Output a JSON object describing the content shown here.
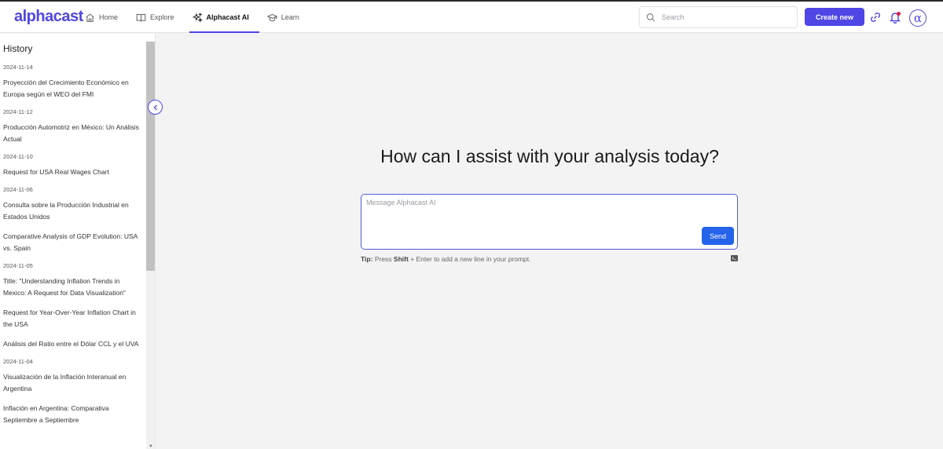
{
  "header": {
    "logo": "alphacast",
    "nav": [
      {
        "label": "Home",
        "icon": "home-icon"
      },
      {
        "label": "Explore",
        "icon": "book-icon"
      },
      {
        "label": "Alphacast AI",
        "icon": "sparkles-icon",
        "active": true
      },
      {
        "label": "Learn",
        "icon": "graduation-cap-icon"
      }
    ],
    "search_placeholder": "Search",
    "create_label": "Create new",
    "avatar_glyph": "α"
  },
  "sidebar": {
    "title": "History",
    "groups": [
      {
        "date": "2024-11-14",
        "items": [
          "Proyección del Crecimiento Económico en Europa según el WEO del FMI"
        ]
      },
      {
        "date": "2024-11-12",
        "items": [
          "Producción Automotriz en México: Un Análisis Actual"
        ]
      },
      {
        "date": "2024-11-10",
        "items": [
          "Request for USA Real Wages Chart"
        ]
      },
      {
        "date": "2024-11-06",
        "items": [
          "Consulta sobre la Producción Industrial en Estados Unidos",
          "Comparative Analysis of GDP Evolution: USA vs. Spain"
        ]
      },
      {
        "date": "2024-11-05",
        "items": [
          "Title: \"Understanding Inflation Trends in Mexico: A Request for Data Visualization\"",
          "Request for Year-Over-Year Inflation Chart in the USA",
          "Análisis del Ratio entre el Dólar CCL y el UVA"
        ]
      },
      {
        "date": "2024-11-04",
        "items": [
          "Visualización de la Inflación Interanual en Argentina",
          "Inflación en Argentina: Comparativa Septiembre a Septiembre"
        ]
      }
    ]
  },
  "main": {
    "headline": "How can I assist with your analysis today?",
    "prompt_placeholder": "Message Alphacast AI",
    "send_label": "Send",
    "tip_label": "Tip:",
    "tip_pre": "Press",
    "tip_key": "Shift",
    "tip_post": "+ Enter to add a new line in your prompt."
  },
  "colors": {
    "accent": "#4f46e5",
    "send": "#2563eb",
    "notification": "#e11d48"
  }
}
